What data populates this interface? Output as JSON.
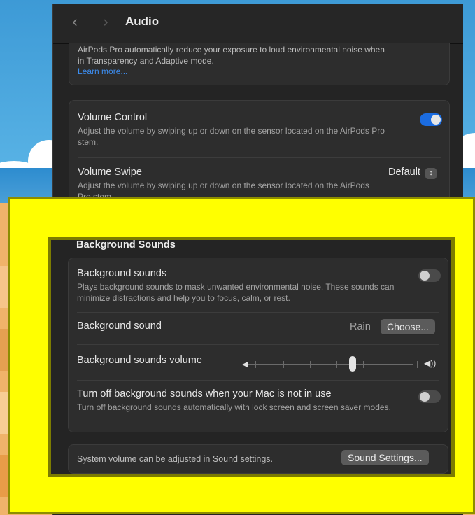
{
  "window": {
    "title": "Audio",
    "back_icon": "chevron-left-icon",
    "forward_icon": "chevron-right-icon"
  },
  "top_group": {
    "text_line1": "AirPods Pro automatically reduce your exposure to loud environmental noise when",
    "text_line2": "in Transparency and Adaptive mode.",
    "link": "Learn more..."
  },
  "volume_group": {
    "volume_control": {
      "title": "Volume Control",
      "desc": "Adjust the volume by swiping up or down on the sensor located on the AirPods Pro stem.",
      "enabled": true
    },
    "volume_swipe": {
      "title": "Volume Swipe",
      "desc": "Adjust the volume by swiping up or down on the sensor located on the AirPods Pro stem.",
      "value": "Default"
    }
  },
  "background_sounds": {
    "section_title": "Background Sounds",
    "toggle_row": {
      "title": "Background sounds",
      "desc": "Plays background sounds to mask unwanted environmental noise. These sounds can minimize distractions and help you to focus, calm, or rest.",
      "enabled": false
    },
    "sound_row": {
      "title": "Background sound",
      "value": "Rain",
      "button": "Choose..."
    },
    "volume_row": {
      "title": "Background sounds volume",
      "value_fraction": 0.63
    },
    "mac_row": {
      "title": "Turn off background sounds when your Mac is not in use",
      "desc": "Turn off background sounds automatically with lock screen and screen saver modes.",
      "enabled": false
    }
  },
  "footer": {
    "text": "System volume can be adjusted in Sound settings.",
    "button": "Sound Settings..."
  },
  "colors": {
    "highlight": "#ffff00",
    "accent": "#1b6ce0",
    "link": "#3c8df0"
  }
}
